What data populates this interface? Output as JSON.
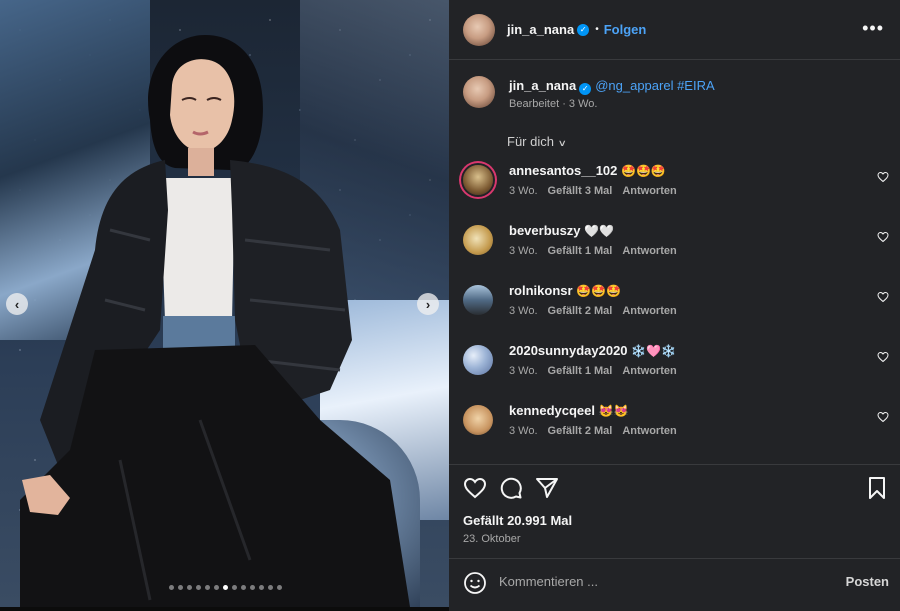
{
  "photo": {
    "prev_arrow": "‹",
    "next_arrow": "›",
    "dots_count": 13,
    "active_dot": 6
  },
  "header": {
    "username": "jin_a_nana",
    "verified": true,
    "bullet": "•",
    "follow_label": "Folgen",
    "more_label": "•••"
  },
  "caption": {
    "username": "jin_a_nana",
    "text": "@ng_apparel #EIRA",
    "meta": "Bearbeitet · 3 Wo."
  },
  "filter": {
    "label": "Für dich",
    "chevron": "⌄"
  },
  "comments": [
    {
      "username": "annesantos__102",
      "text": "🤩🤩🤩",
      "time": "3 Wo.",
      "likes": "Gefällt 3 Mal",
      "reply": "Antworten"
    },
    {
      "username": "beverbuszy",
      "text": "🤍🤍",
      "time": "3 Wo.",
      "likes": "Gefällt 1 Mal",
      "reply": "Antworten"
    },
    {
      "username": "rolnikonsr",
      "text": "🤩🤩🤩",
      "time": "3 Wo.",
      "likes": "Gefällt 2 Mal",
      "reply": "Antworten"
    },
    {
      "username": "2020sunnyday2020",
      "text": "❄️🩷❄️",
      "time": "3 Wo.",
      "likes": "Gefällt 1 Mal",
      "reply": "Antworten"
    },
    {
      "username": "kennedycqeel",
      "text": "😻😻",
      "time": "3 Wo.",
      "likes": "Gefällt 2 Mal",
      "reply": "Antworten"
    }
  ],
  "stats": {
    "likes": "Gefällt 20.991 Mal",
    "date": "23. Oktober"
  },
  "composer": {
    "placeholder": "Kommentieren ...",
    "post_label": "Posten"
  },
  "colors": {
    "panel_bg": "#222326",
    "link_blue": "#4ca3f7",
    "verified_blue": "#0095f6",
    "muted_text": "#a8a8a8"
  }
}
